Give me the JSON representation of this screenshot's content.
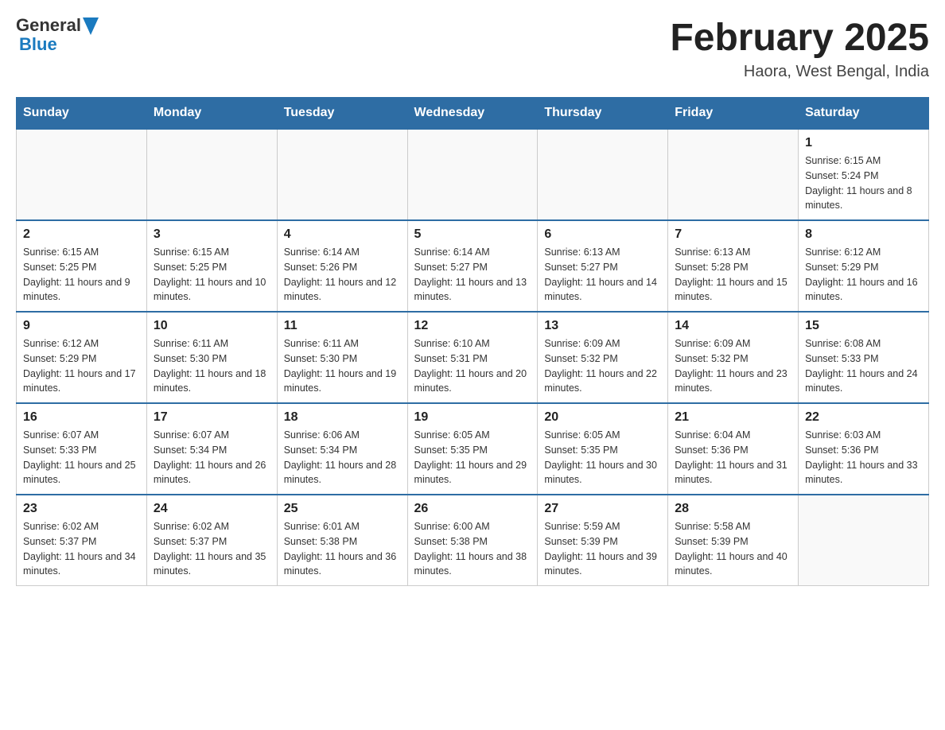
{
  "header": {
    "logo": {
      "general": "General",
      "blue": "Blue"
    },
    "title": "February 2025",
    "location": "Haora, West Bengal, India"
  },
  "weekdays": [
    "Sunday",
    "Monday",
    "Tuesday",
    "Wednesday",
    "Thursday",
    "Friday",
    "Saturday"
  ],
  "weeks": [
    [
      {
        "day": "",
        "info": ""
      },
      {
        "day": "",
        "info": ""
      },
      {
        "day": "",
        "info": ""
      },
      {
        "day": "",
        "info": ""
      },
      {
        "day": "",
        "info": ""
      },
      {
        "day": "",
        "info": ""
      },
      {
        "day": "1",
        "info": "Sunrise: 6:15 AM\nSunset: 5:24 PM\nDaylight: 11 hours and 8 minutes."
      }
    ],
    [
      {
        "day": "2",
        "info": "Sunrise: 6:15 AM\nSunset: 5:25 PM\nDaylight: 11 hours and 9 minutes."
      },
      {
        "day": "3",
        "info": "Sunrise: 6:15 AM\nSunset: 5:25 PM\nDaylight: 11 hours and 10 minutes."
      },
      {
        "day": "4",
        "info": "Sunrise: 6:14 AM\nSunset: 5:26 PM\nDaylight: 11 hours and 12 minutes."
      },
      {
        "day": "5",
        "info": "Sunrise: 6:14 AM\nSunset: 5:27 PM\nDaylight: 11 hours and 13 minutes."
      },
      {
        "day": "6",
        "info": "Sunrise: 6:13 AM\nSunset: 5:27 PM\nDaylight: 11 hours and 14 minutes."
      },
      {
        "day": "7",
        "info": "Sunrise: 6:13 AM\nSunset: 5:28 PM\nDaylight: 11 hours and 15 minutes."
      },
      {
        "day": "8",
        "info": "Sunrise: 6:12 AM\nSunset: 5:29 PM\nDaylight: 11 hours and 16 minutes."
      }
    ],
    [
      {
        "day": "9",
        "info": "Sunrise: 6:12 AM\nSunset: 5:29 PM\nDaylight: 11 hours and 17 minutes."
      },
      {
        "day": "10",
        "info": "Sunrise: 6:11 AM\nSunset: 5:30 PM\nDaylight: 11 hours and 18 minutes."
      },
      {
        "day": "11",
        "info": "Sunrise: 6:11 AM\nSunset: 5:30 PM\nDaylight: 11 hours and 19 minutes."
      },
      {
        "day": "12",
        "info": "Sunrise: 6:10 AM\nSunset: 5:31 PM\nDaylight: 11 hours and 20 minutes."
      },
      {
        "day": "13",
        "info": "Sunrise: 6:09 AM\nSunset: 5:32 PM\nDaylight: 11 hours and 22 minutes."
      },
      {
        "day": "14",
        "info": "Sunrise: 6:09 AM\nSunset: 5:32 PM\nDaylight: 11 hours and 23 minutes."
      },
      {
        "day": "15",
        "info": "Sunrise: 6:08 AM\nSunset: 5:33 PM\nDaylight: 11 hours and 24 minutes."
      }
    ],
    [
      {
        "day": "16",
        "info": "Sunrise: 6:07 AM\nSunset: 5:33 PM\nDaylight: 11 hours and 25 minutes."
      },
      {
        "day": "17",
        "info": "Sunrise: 6:07 AM\nSunset: 5:34 PM\nDaylight: 11 hours and 26 minutes."
      },
      {
        "day": "18",
        "info": "Sunrise: 6:06 AM\nSunset: 5:34 PM\nDaylight: 11 hours and 28 minutes."
      },
      {
        "day": "19",
        "info": "Sunrise: 6:05 AM\nSunset: 5:35 PM\nDaylight: 11 hours and 29 minutes."
      },
      {
        "day": "20",
        "info": "Sunrise: 6:05 AM\nSunset: 5:35 PM\nDaylight: 11 hours and 30 minutes."
      },
      {
        "day": "21",
        "info": "Sunrise: 6:04 AM\nSunset: 5:36 PM\nDaylight: 11 hours and 31 minutes."
      },
      {
        "day": "22",
        "info": "Sunrise: 6:03 AM\nSunset: 5:36 PM\nDaylight: 11 hours and 33 minutes."
      }
    ],
    [
      {
        "day": "23",
        "info": "Sunrise: 6:02 AM\nSunset: 5:37 PM\nDaylight: 11 hours and 34 minutes."
      },
      {
        "day": "24",
        "info": "Sunrise: 6:02 AM\nSunset: 5:37 PM\nDaylight: 11 hours and 35 minutes."
      },
      {
        "day": "25",
        "info": "Sunrise: 6:01 AM\nSunset: 5:38 PM\nDaylight: 11 hours and 36 minutes."
      },
      {
        "day": "26",
        "info": "Sunrise: 6:00 AM\nSunset: 5:38 PM\nDaylight: 11 hours and 38 minutes."
      },
      {
        "day": "27",
        "info": "Sunrise: 5:59 AM\nSunset: 5:39 PM\nDaylight: 11 hours and 39 minutes."
      },
      {
        "day": "28",
        "info": "Sunrise: 5:58 AM\nSunset: 5:39 PM\nDaylight: 11 hours and 40 minutes."
      },
      {
        "day": "",
        "info": ""
      }
    ]
  ]
}
